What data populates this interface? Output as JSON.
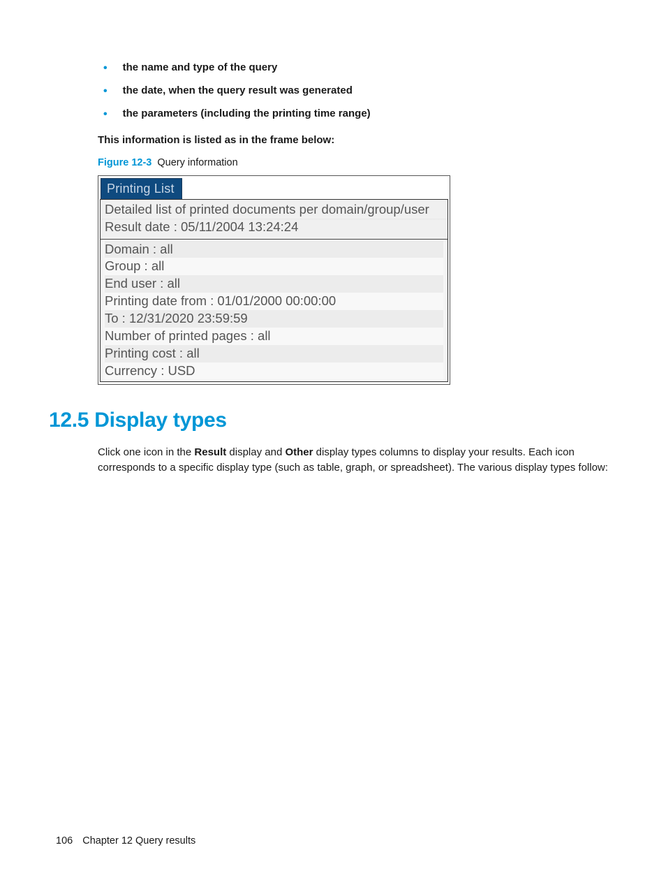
{
  "bullets": [
    "the name and type of the query",
    "the date, when the query result was generated",
    "the parameters (including the printing time range)"
  ],
  "intro_para": "This information is listed as in the frame below:",
  "figure": {
    "number": "Figure 12-3",
    "title": "Query information"
  },
  "screenshot": {
    "tab": "Printing List",
    "header1": "Detailed list of printed documents per domain/group/user",
    "header2": "Result date : 05/11/2004 13:24:24",
    "rows": [
      "Domain : all",
      "Group : all",
      "End user : all",
      "Printing date from : 01/01/2000 00:00:00",
      "To : 12/31/2020 23:59:59",
      "Number of printed pages : all",
      "Printing cost : all",
      "Currency : USD"
    ]
  },
  "section": {
    "heading": "12.5 Display types",
    "para_pre": "Click one icon in the ",
    "para_b1": "Result",
    "para_mid1": " display and ",
    "para_b2": "Other",
    "para_post": " display types columns to display your results. Each icon corresponds to a specific display type (such as table, graph, or spreadsheet). The various display types follow:"
  },
  "footer": {
    "page": "106",
    "chapter": "Chapter 12   Query results"
  }
}
